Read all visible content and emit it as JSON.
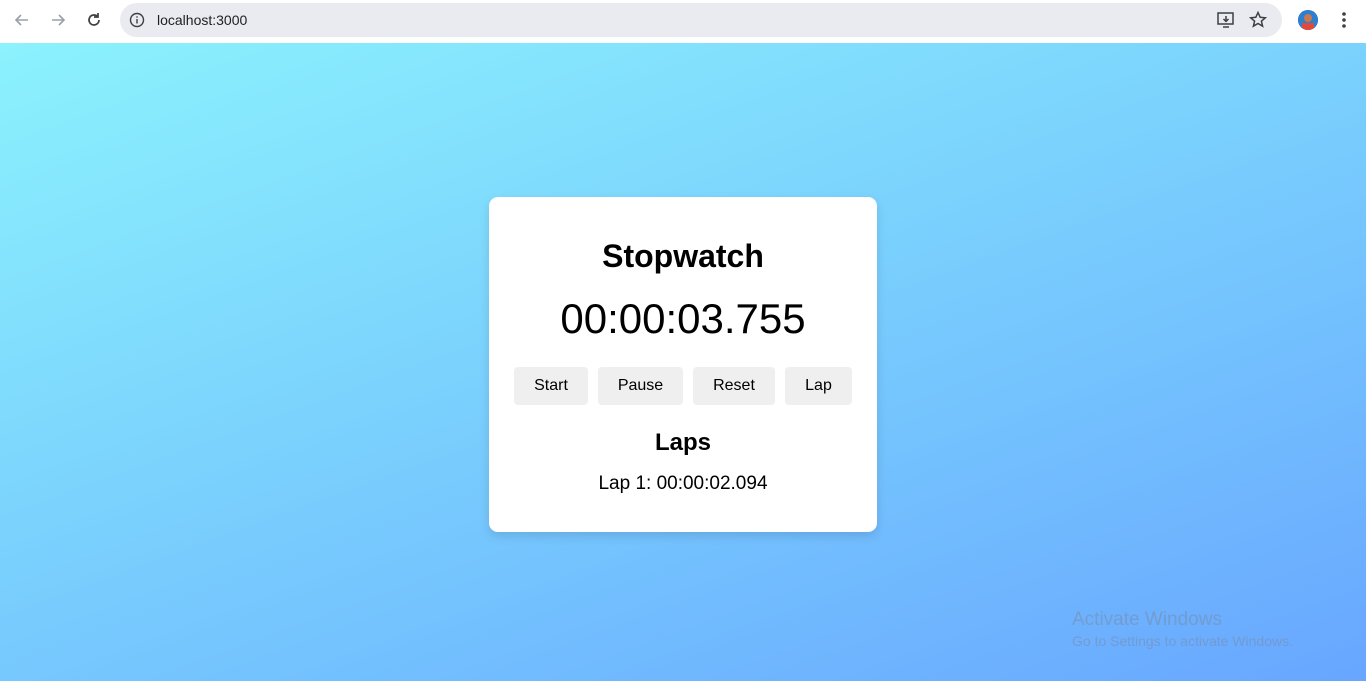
{
  "browser": {
    "url": "localhost:3000"
  },
  "app": {
    "title": "Stopwatch",
    "time": "00:00:03.755",
    "buttons": {
      "start": "Start",
      "pause": "Pause",
      "reset": "Reset",
      "lap": "Lap"
    },
    "laps_heading": "Laps",
    "laps": [
      "Lap 1: 00:00:02.094"
    ]
  },
  "watermark": {
    "line1": "Activate Windows",
    "line2": "Go to Settings to activate Windows."
  },
  "colors": {
    "gradient_start": "#8cf2fd",
    "gradient_end": "#68a6ff",
    "card": "#ffffff",
    "button": "#efefef"
  }
}
